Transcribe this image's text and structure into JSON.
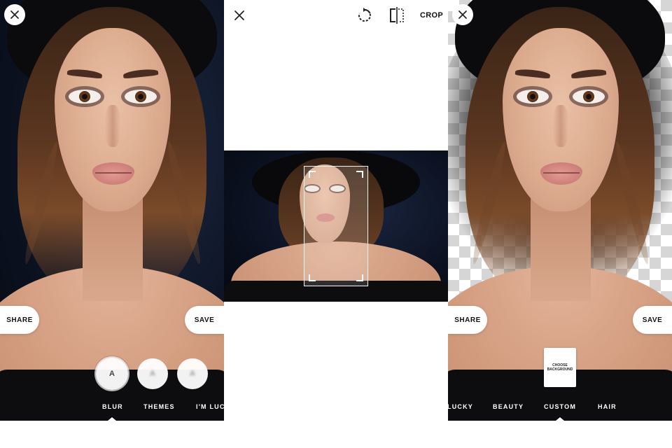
{
  "left_panel": {
    "actions": {
      "share_label": "SHARE",
      "save_label": "SAVE"
    },
    "filters": [
      {
        "letter": "A",
        "state": "selected"
      },
      {
        "letter": "A",
        "state": "blurred"
      },
      {
        "letter": "A",
        "state": "blurred"
      }
    ],
    "tabs": [
      "BLUR",
      "THEMES",
      "I'M LUC"
    ],
    "active_tab": "BLUR"
  },
  "crop_panel": {
    "toolbar": {
      "crop_label": "CROP"
    },
    "icons": [
      "close-icon",
      "rotate-icon",
      "flip-icon"
    ]
  },
  "right_panel": {
    "actions": {
      "share_label": "SHARE",
      "save_label": "SAVE"
    },
    "background_card": {
      "label": "CHOOSE BACKGROUND"
    },
    "tabs": [
      "LUCKY",
      "BEAUTY",
      "CUSTOM",
      "HAIR"
    ],
    "active_tab": "CUSTOM"
  },
  "colors": {
    "dark_background": "#0c1322",
    "accent_white": "#ffffff",
    "checker": "#d6d6d6"
  }
}
